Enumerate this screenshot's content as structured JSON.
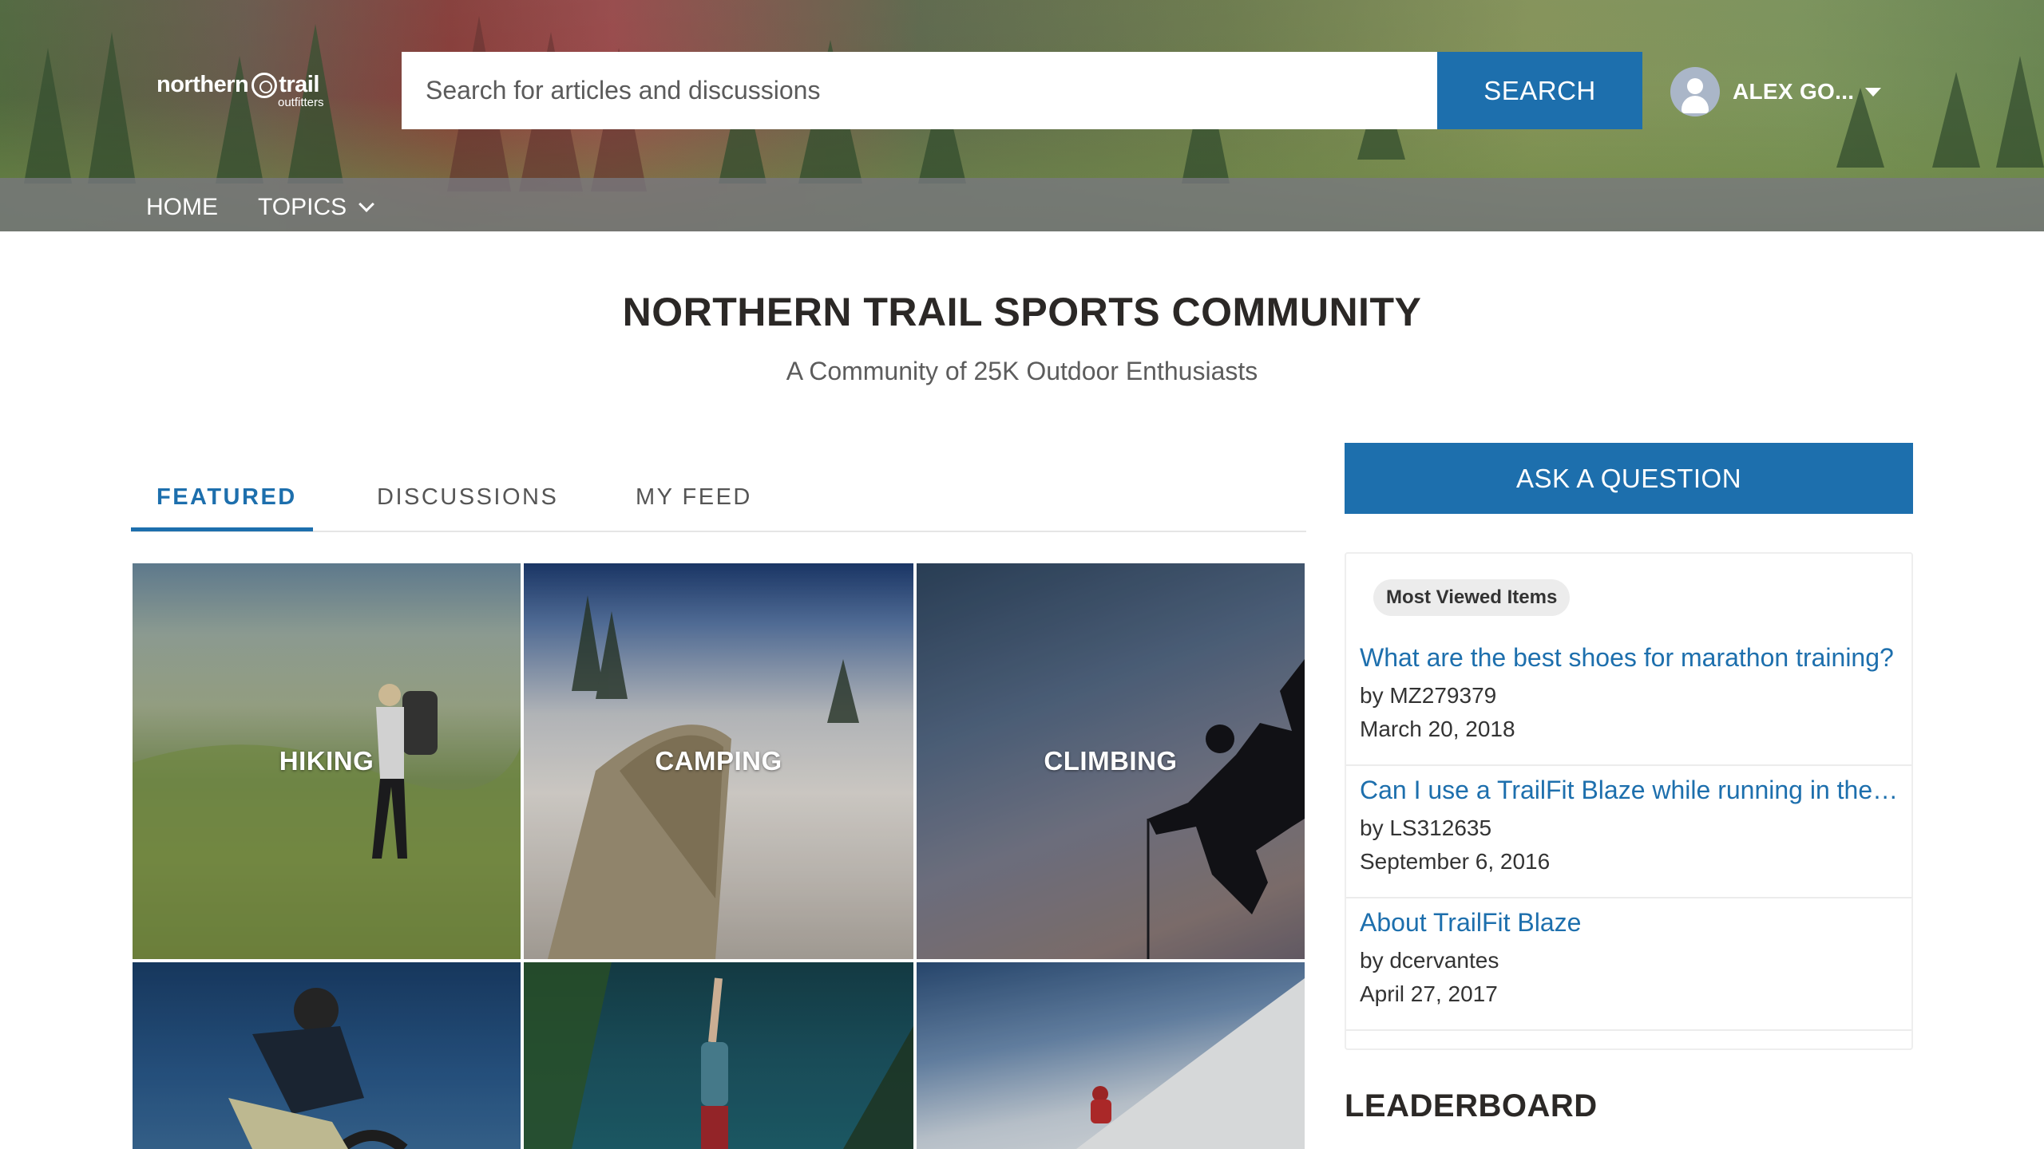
{
  "header": {
    "logo_text": "northern",
    "logo_text2": "trail",
    "logo_sub": "outfitters",
    "search_placeholder": "Search for articles and discussions",
    "search_button": "SEARCH",
    "user_name": "ALEX GO..."
  },
  "nav": {
    "home": "HOME",
    "topics": "TOPICS"
  },
  "hero": {
    "title": "NORTHERN TRAIL SPORTS COMMUNITY",
    "subtitle": "A Community of 25K Outdoor Enthusiasts"
  },
  "tabs": [
    {
      "label": "FEATURED",
      "active": true
    },
    {
      "label": "DISCUSSIONS",
      "active": false
    },
    {
      "label": "MY FEED",
      "active": false
    }
  ],
  "tiles": [
    {
      "label": "HIKING"
    },
    {
      "label": "CAMPING"
    },
    {
      "label": "CLIMBING"
    },
    {
      "label": ""
    },
    {
      "label": ""
    },
    {
      "label": ""
    }
  ],
  "sidebar": {
    "ask_button": "ASK A QUESTION",
    "most_viewed_label": "Most Viewed Items",
    "items": [
      {
        "title": "What are the best shoes for marathon training?",
        "author": "by MZ279379",
        "date": "March 20, 2018"
      },
      {
        "title": "Can I use a TrailFit Blaze while running in the rain?",
        "author": "by LS312635",
        "date": "September 6, 2016"
      },
      {
        "title": "About TrailFit Blaze",
        "author": "by dcervantes",
        "date": "April 27, 2017"
      }
    ],
    "leaderboard_title": "LEADERBOARD"
  },
  "colors": {
    "accent": "#1d6fad",
    "title_text": "#2b2826",
    "navbar": "#787880"
  }
}
